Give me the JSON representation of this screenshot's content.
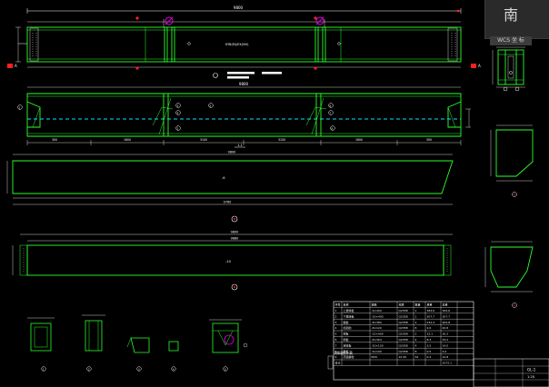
{
  "viewcube": {
    "direction_label": "南",
    "ucs_label": "WCS  坐  标"
  },
  "colors": {
    "background": "#000000",
    "outline_green": "#2bff2b",
    "centerline_cyan": "#00e5ff",
    "dim_white": "#ffffff",
    "stiffener_magenta": "#e000e0",
    "marker_red": "#ff2020"
  },
  "drawing": {
    "top_view_overall_dim": "9800",
    "top_view_note": "KYB(M)/EX(HH)",
    "section_tag_left": "A",
    "section_tag_right": "A",
    "section_cut_label": "1-1",
    "side_view_overall_dim": "9800",
    "side_view_segments": [
      "300",
      "1600",
      "3100",
      "3100",
      "1600",
      "300"
    ],
    "part1_top_dim": "9800",
    "part1_bottom_dim": "9760",
    "part1_label": "-6",
    "part2_top_dim": "9800",
    "part2_mid_dim": "9680",
    "part2_label": "-10",
    "callouts": [
      "1",
      "2",
      "3",
      "4",
      "5",
      "6",
      "7",
      "8"
    ],
    "detail_labels": [
      "1",
      "2",
      "3",
      "4",
      "5",
      "6",
      "7",
      "8"
    ]
  },
  "bom_table": {
    "headers": [
      "序号",
      "名称",
      "规格",
      "材质",
      "数量",
      "单重",
      "总重"
    ],
    "rows": [
      [
        "1",
        "上翼缘板",
        "-6×400",
        "Q235B",
        "1",
        "184.6",
        "184.6"
      ],
      [
        "2",
        "下翼缘板",
        "-10×400",
        "Q235B",
        "1",
        "307.7",
        "307.7"
      ],
      [
        "3",
        "腹板",
        "-8×380",
        "Q235B",
        "2",
        "232.4",
        "464.8"
      ],
      [
        "4",
        "加劲肋",
        "-8×120",
        "Q235B",
        "8",
        "2.6",
        "20.8"
      ],
      [
        "5",
        "端板",
        "-12×400",
        "Q235B",
        "2",
        "15.1",
        "30.2"
      ],
      [
        "6",
        "隔板",
        "-8×364",
        "Q235B",
        "4",
        "8.3",
        "33.2"
      ],
      [
        "7",
        "连接板",
        "-10×150",
        "Q235B",
        "4",
        "3.5",
        "14.0"
      ],
      [
        "8",
        "垫板",
        "-6×100",
        "Q235B",
        "8",
        "0.5",
        "4.0"
      ],
      [
        "9",
        "高强螺栓",
        "M20",
        "10.9S",
        "32",
        "0.4",
        "12.8"
      ]
    ],
    "total_label": "合计",
    "total_value": "1072.1"
  },
  "title_block": {
    "stamp": "材料统计表",
    "drawing_no": "GL-1",
    "scale": "1:20"
  }
}
